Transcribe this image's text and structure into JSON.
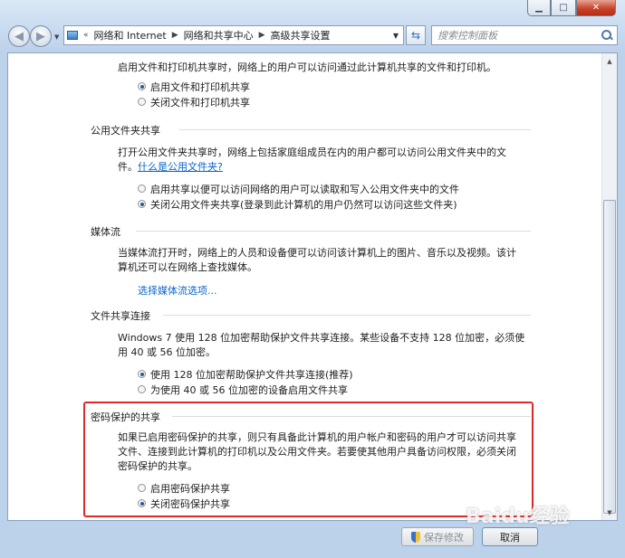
{
  "window": {
    "minimize": "▁",
    "maximize": "□",
    "close": "✕"
  },
  "nav": {
    "back": "◀",
    "forward": "▶",
    "breadcrumb": [
      "网络和 Internet",
      "网络和共享中心",
      "高级共享设置"
    ],
    "search_placeholder": "搜索控制面板"
  },
  "sections": {
    "file_printer": {
      "description": "启用文件和打印机共享时，网络上的用户可以访问通过此计算机共享的文件和打印机。",
      "options": [
        "启用文件和打印机共享",
        "关闭文件和打印机共享"
      ],
      "selected": 0
    },
    "public_folder": {
      "title": "公用文件夹共享",
      "description": "打开公用文件夹共享时，网络上包括家庭组成员在内的用户都可以访问公用文件夹中的文件。",
      "link": "什么是公用文件夹?",
      "options": [
        "启用共享以便可以访问网络的用户可以读取和写入公用文件夹中的文件",
        "关闭公用文件夹共享(登录到此计算机的用户仍然可以访问这些文件夹)"
      ],
      "selected": 1
    },
    "media": {
      "title": "媒体流",
      "description": "当媒体流打开时，网络上的人员和设备便可以访问该计算机上的图片、音乐以及视频。该计算机还可以在网络上查找媒体。",
      "link": "选择媒体流选项..."
    },
    "encryption": {
      "title": "文件共享连接",
      "description": "Windows 7 使用 128 位加密帮助保护文件共享连接。某些设备不支持 128 位加密，必须使用 40 或 56 位加密。",
      "options": [
        "使用 128 位加密帮助保护文件共享连接(推荐)",
        "为使用 40 或 56 位加密的设备启用文件共享"
      ],
      "selected": 0
    },
    "password": {
      "title": "密码保护的共享",
      "description": "如果已启用密码保护的共享，则只有具备此计算机的用户帐户和密码的用户才可以访问共享文件、连接到此计算机的打印机以及公用文件夹。若要使其他用户具备访问权限，必须关闭密码保护的共享。",
      "options": [
        "启用密码保护共享",
        "关闭密码保护共享"
      ],
      "selected": 1
    }
  },
  "buttons": {
    "save": "保存修改",
    "cancel": "取消"
  },
  "watermark": "Baidu经验"
}
